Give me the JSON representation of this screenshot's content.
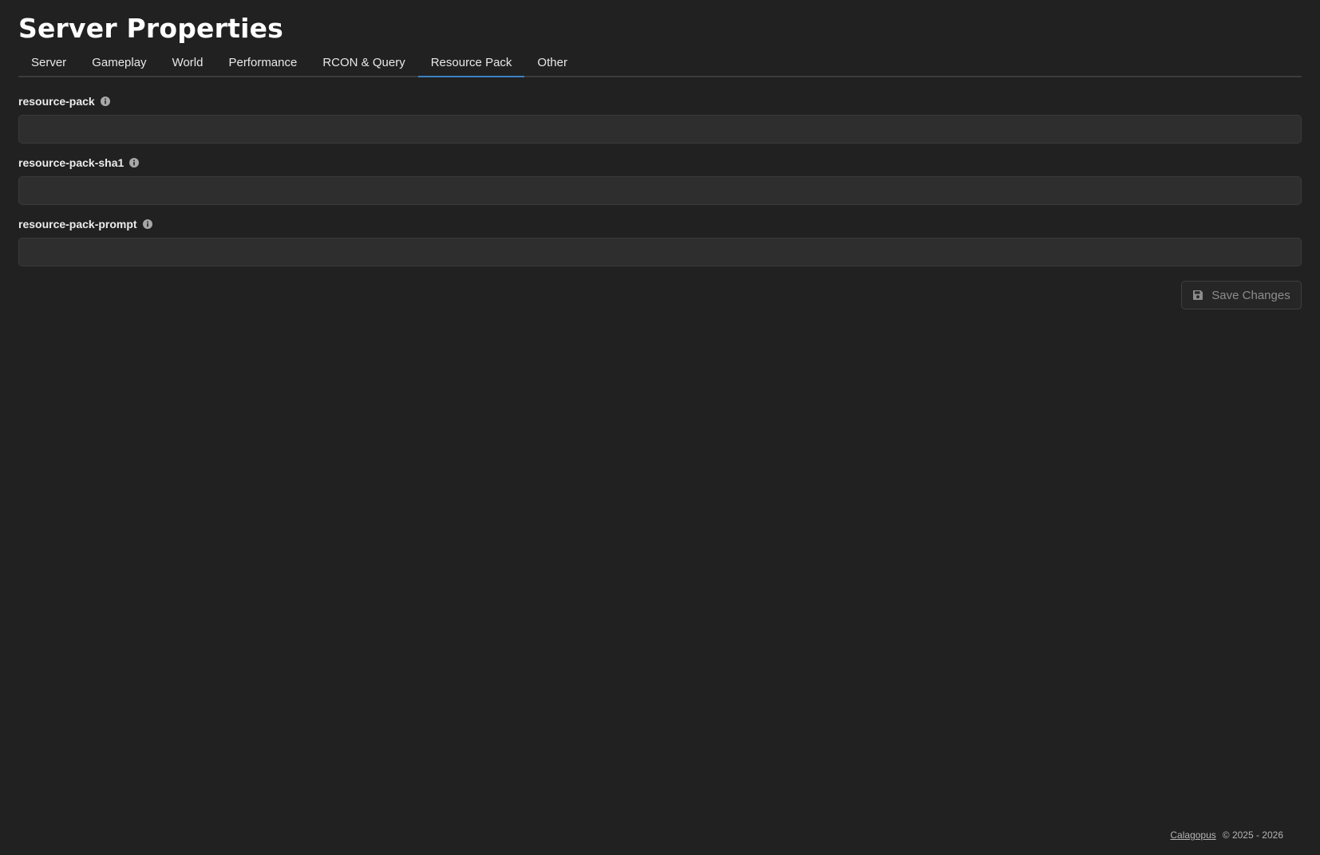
{
  "page": {
    "title": "Server Properties"
  },
  "tabs": [
    {
      "label": "Server"
    },
    {
      "label": "Gameplay"
    },
    {
      "label": "World"
    },
    {
      "label": "Performance"
    },
    {
      "label": "RCON & Query"
    },
    {
      "label": "Resource Pack",
      "active": true
    },
    {
      "label": "Other"
    }
  ],
  "fields": [
    {
      "label": "resource-pack",
      "value": "",
      "placeholder": ""
    },
    {
      "label": "resource-pack-sha1",
      "value": "",
      "placeholder": ""
    },
    {
      "label": "resource-pack-prompt",
      "value": "",
      "placeholder": ""
    }
  ],
  "actions": {
    "save_label": "Save Changes",
    "save_icon": "save-icon"
  },
  "footer": {
    "brand_link": "Calagopus",
    "copyright": "© 2025 - 2026"
  },
  "colors": {
    "background": "#212121",
    "accent": "#3b82c4",
    "input_bg": "#2e2e2e"
  }
}
